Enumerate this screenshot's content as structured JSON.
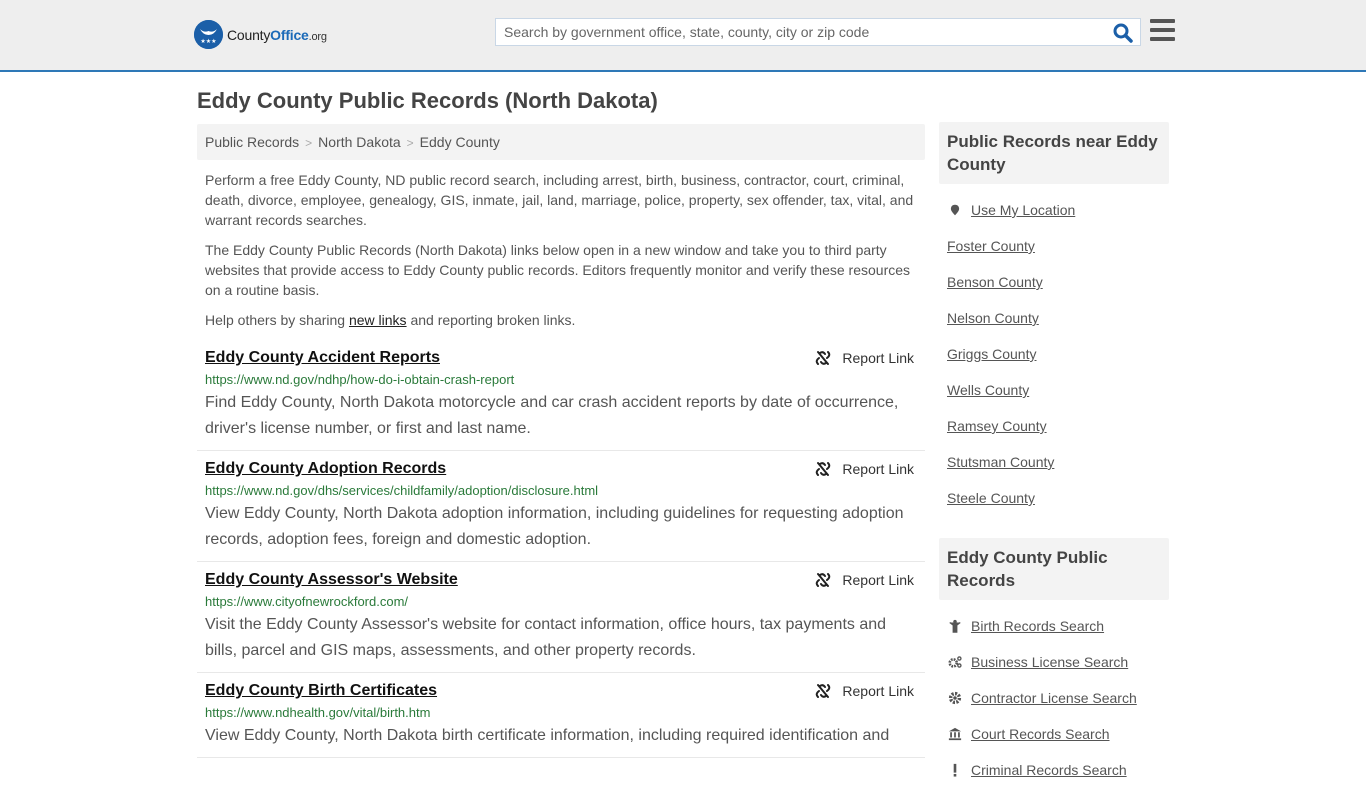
{
  "header": {
    "logo": {
      "prefix": "County",
      "brand": "Office",
      "tld": ".org"
    },
    "search_placeholder": "Search by government office, state, county, city or zip code",
    "search_icon": "search-icon",
    "menu_icon": "hamburger-menu-icon"
  },
  "page_title": "Eddy County Public Records (North Dakota)",
  "breadcrumb": [
    "Public Records",
    "North Dakota",
    "Eddy County"
  ],
  "intro": {
    "p1": "Perform a free Eddy County, ND public record search, including arrest, birth, business, contractor, court, criminal, death, divorce, employee, genealogy, GIS, inmate, jail, land, marriage, police, property, sex offender, tax, vital, and warrant records searches.",
    "p2": "The Eddy County Public Records (North Dakota) links below open in a new window and take you to third party websites that provide access to Eddy County public records. Editors frequently monitor and verify these resources on a routine basis.",
    "p3_before": "Help others by sharing ",
    "p3_link": "new links",
    "p3_after": " and reporting broken links."
  },
  "report_label": "Report Link",
  "records": [
    {
      "title": "Eddy County Accident Reports",
      "url": "https://www.nd.gov/ndhp/how-do-i-obtain-crash-report",
      "desc": "Find Eddy County, North Dakota motorcycle and car crash accident reports by date of occurrence, driver's license number, or first and last name."
    },
    {
      "title": "Eddy County Adoption Records",
      "url": "https://www.nd.gov/dhs/services/childfamily/adoption/disclosure.html",
      "desc": "View Eddy County, North Dakota adoption information, including guidelines for requesting adoption records, adoption fees, foreign and domestic adoption."
    },
    {
      "title": "Eddy County Assessor's Website",
      "url": "https://www.cityofnewrockford.com/",
      "desc": "Visit the Eddy County Assessor's website for contact information, office hours, tax payments and bills, parcel and GIS maps, assessments, and other property records."
    },
    {
      "title": "Eddy County Birth Certificates",
      "url": "https://www.ndhealth.gov/vital/birth.htm",
      "desc": "View Eddy County, North Dakota birth certificate information, including required identification and"
    }
  ],
  "sidebar": {
    "nearby_title": "Public Records near Eddy County",
    "use_location": "Use My Location",
    "nearby": [
      "Foster County",
      "Benson County",
      "Nelson County",
      "Griggs County",
      "Wells County",
      "Ramsey County",
      "Stutsman County",
      "Steele County"
    ],
    "records_title": "Eddy County Public Records",
    "records_links": [
      {
        "label": "Birth Records Search",
        "icon": "child-icon"
      },
      {
        "label": "Business License Search",
        "icon": "cogs-icon"
      },
      {
        "label": "Contractor License Search",
        "icon": "gear-icon"
      },
      {
        "label": "Court Records Search",
        "icon": "courthouse-icon"
      },
      {
        "label": "Criminal Records Search",
        "icon": "exclamation-icon"
      }
    ]
  }
}
